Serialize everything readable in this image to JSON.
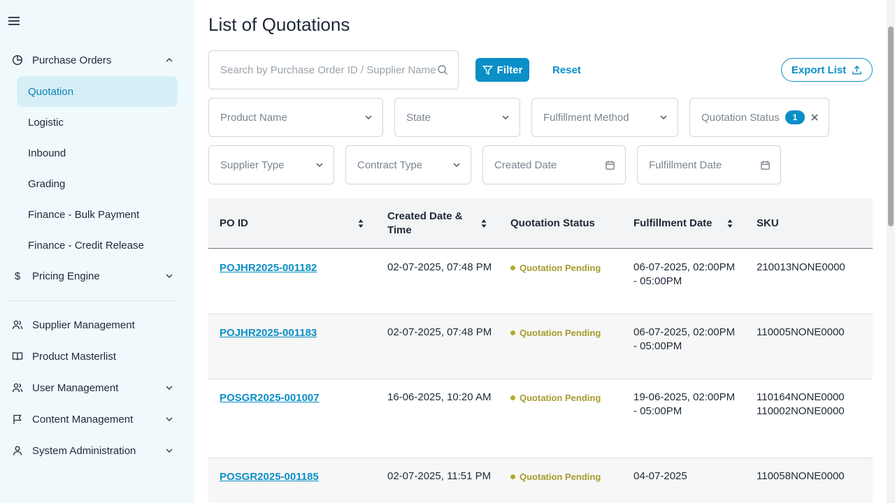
{
  "sidebar": {
    "groups": [
      {
        "label": "Purchase Orders",
        "icon": "pie-chart-icon",
        "expanded": true
      },
      {
        "label": "Pricing Engine",
        "icon": "dollar-icon",
        "expanded": false
      },
      {
        "label": "Supplier Management",
        "icon": "users-icon"
      },
      {
        "label": "Product Masterlist",
        "icon": "book-icon"
      },
      {
        "label": "User Management",
        "icon": "users-icon",
        "expanded": false
      },
      {
        "label": "Content Management",
        "icon": "flag-icon",
        "expanded": false
      },
      {
        "label": "System Administration",
        "icon": "user-icon",
        "expanded": false
      }
    ],
    "sub_items": [
      {
        "label": "Quotation",
        "active": true
      },
      {
        "label": "Logistic"
      },
      {
        "label": "Inbound"
      },
      {
        "label": "Grading"
      },
      {
        "label": "Finance - Bulk Payment"
      },
      {
        "label": "Finance - Credit Release"
      }
    ]
  },
  "page": {
    "title": "List of Quotations"
  },
  "toolbar": {
    "search_placeholder": "Search by Purchase Order ID / Supplier Name",
    "filter_label": "Filter",
    "reset_label": "Reset",
    "export_label": "Export List"
  },
  "filters": [
    {
      "label": "Product Name",
      "kind": "dropdown"
    },
    {
      "label": "State",
      "kind": "dropdown"
    },
    {
      "label": "Fulfillment Method",
      "kind": "dropdown"
    },
    {
      "label": "Quotation Status",
      "kind": "badge",
      "count": "1"
    },
    {
      "label": "Supplier Type",
      "kind": "dropdown"
    },
    {
      "label": "Contract Type",
      "kind": "dropdown"
    },
    {
      "label": "Created Date",
      "kind": "date"
    },
    {
      "label": "Fulfillment Date",
      "kind": "date"
    }
  ],
  "table": {
    "headers": [
      "PO ID",
      "Created Date & Time",
      "Quotation Status",
      "Fulfillment Date",
      "SKU"
    ],
    "rows": [
      {
        "po_id": "POJHR2025-001182",
        "created": "02-07-2025, 07:48 PM",
        "status": "Quotation Pending",
        "fulfillment": "06-07-2025, 02:00PM - 05:00PM",
        "sku": [
          "210013NONE0000"
        ]
      },
      {
        "po_id": "POJHR2025-001183",
        "created": "02-07-2025, 07:48 PM",
        "status": "Quotation Pending",
        "fulfillment": "06-07-2025, 02:00PM - 05:00PM",
        "sku": [
          "110005NONE0000"
        ]
      },
      {
        "po_id": "POSGR2025-001007",
        "created": "16-06-2025, 10:20 AM",
        "status": "Quotation Pending",
        "fulfillment": "19-06-2025, 02:00PM - 05:00PM",
        "sku": [
          "110164NONE0000",
          "110002NONE0000"
        ]
      },
      {
        "po_id": "POSGR2025-001185",
        "created": "02-07-2025, 11:51 PM",
        "status": "Quotation Pending",
        "fulfillment": "04-07-2025",
        "sku": [
          "110058NONE0000"
        ]
      }
    ]
  },
  "colors": {
    "accent": "#0a8fc7",
    "sidebar_bg": "#f0fafd",
    "active_bg": "#d6eff7",
    "status_pending": "#a89b2e"
  }
}
